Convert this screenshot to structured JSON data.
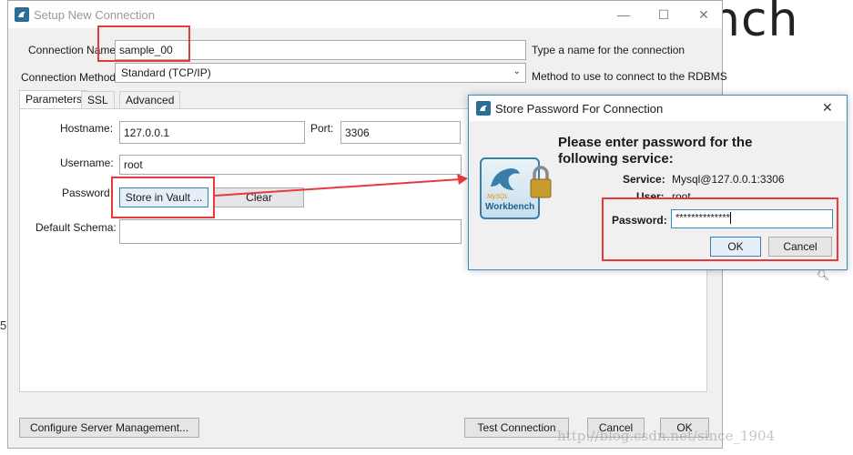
{
  "background": {
    "heading_fragment": "nch",
    "side_fragment": "5",
    "watermark": "http://blog.csdn.net/since_1904"
  },
  "main": {
    "title": "Setup New Connection",
    "minimize": "—",
    "maximize": "☐",
    "close": "✕",
    "connection_name_label": "Connection Name:",
    "connection_name_value": "sample_00",
    "connection_name_hint": "Type a name for the connection",
    "method_label": "Connection Method:",
    "method_value": "Standard (TCP/IP)",
    "method_hint": "Method to use to connect to the RDBMS",
    "tabs": [
      {
        "label": "Parameters",
        "active": true
      },
      {
        "label": "SSL",
        "active": false
      },
      {
        "label": "Advanced",
        "active": false
      }
    ],
    "hostname_label": "Hostname:",
    "hostname_value": "127.0.0.1",
    "port_label": "Port:",
    "port_value": "3306",
    "username_label": "Username:",
    "username_value": "root",
    "password_label": "Password:",
    "store_vault_label": "Store in Vault ...",
    "clear_label": "Clear",
    "schema_label": "Default Schema:",
    "schema_value": "",
    "configure_label": "Configure Server Management...",
    "test_label": "Test Connection",
    "cancel_label": "Cancel",
    "ok_label": "OK"
  },
  "popup": {
    "title": "Store Password For Connection",
    "close": "✕",
    "heading_line1": "Please enter password for the",
    "heading_line2": "following service:",
    "service_label": "Service:",
    "service_value": "Mysql@127.0.0.1:3306",
    "user_label": "User:",
    "user_value": "root",
    "password_label": "Password:",
    "password_value": "**************",
    "ok_label": "OK",
    "cancel_label": "Cancel",
    "logo_text": "Workbench",
    "logo_small": "MySQL"
  },
  "colors": {
    "highlight": "#e8393f",
    "accent": "#2f8fbd"
  }
}
